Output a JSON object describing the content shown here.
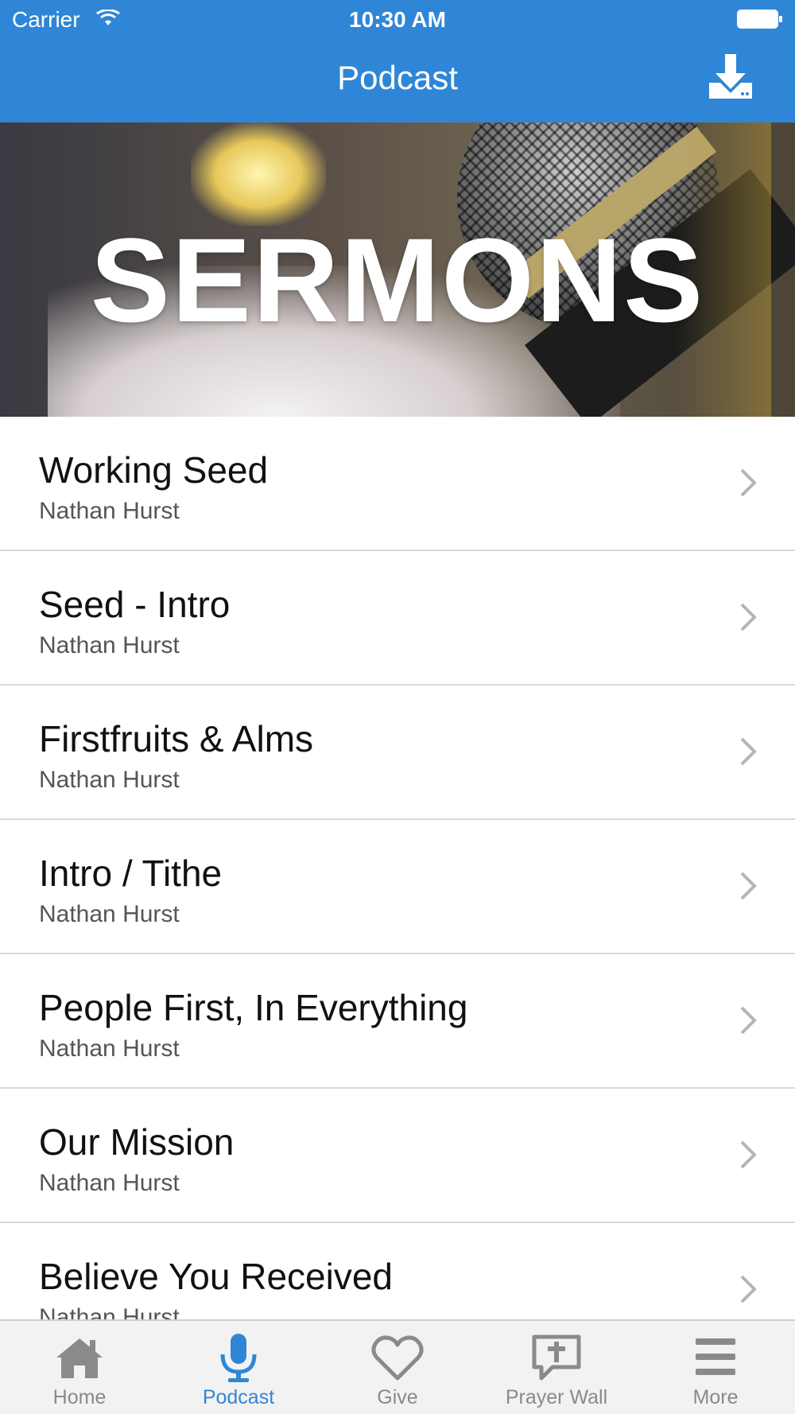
{
  "status_bar": {
    "carrier": "Carrier",
    "time": "10:30 AM"
  },
  "nav": {
    "title": "Podcast",
    "download_icon": "download-icon"
  },
  "banner": {
    "text": "SERMONS"
  },
  "sermons": [
    {
      "title": "Working Seed",
      "speaker": "Nathan Hurst"
    },
    {
      "title": "Seed - Intro",
      "speaker": "Nathan Hurst"
    },
    {
      "title": "Firstfruits & Alms",
      "speaker": "Nathan Hurst"
    },
    {
      "title": "Intro / Tithe",
      "speaker": "Nathan Hurst"
    },
    {
      "title": "People First, In Everything",
      "speaker": "Nathan Hurst"
    },
    {
      "title": "Our Mission",
      "speaker": "Nathan Hurst"
    },
    {
      "title": "Believe You Received",
      "speaker": "Nathan Hurst"
    }
  ],
  "tabs": [
    {
      "label": "Home",
      "icon": "home-icon"
    },
    {
      "label": "Podcast",
      "icon": "microphone-icon",
      "active": true
    },
    {
      "label": "Give",
      "icon": "heart-icon"
    },
    {
      "label": "Prayer Wall",
      "icon": "prayer-bubble-icon"
    },
    {
      "label": "More",
      "icon": "menu-icon"
    }
  ],
  "colors": {
    "accent": "#2f86d6",
    "tab_inactive": "#8a8a8a"
  }
}
